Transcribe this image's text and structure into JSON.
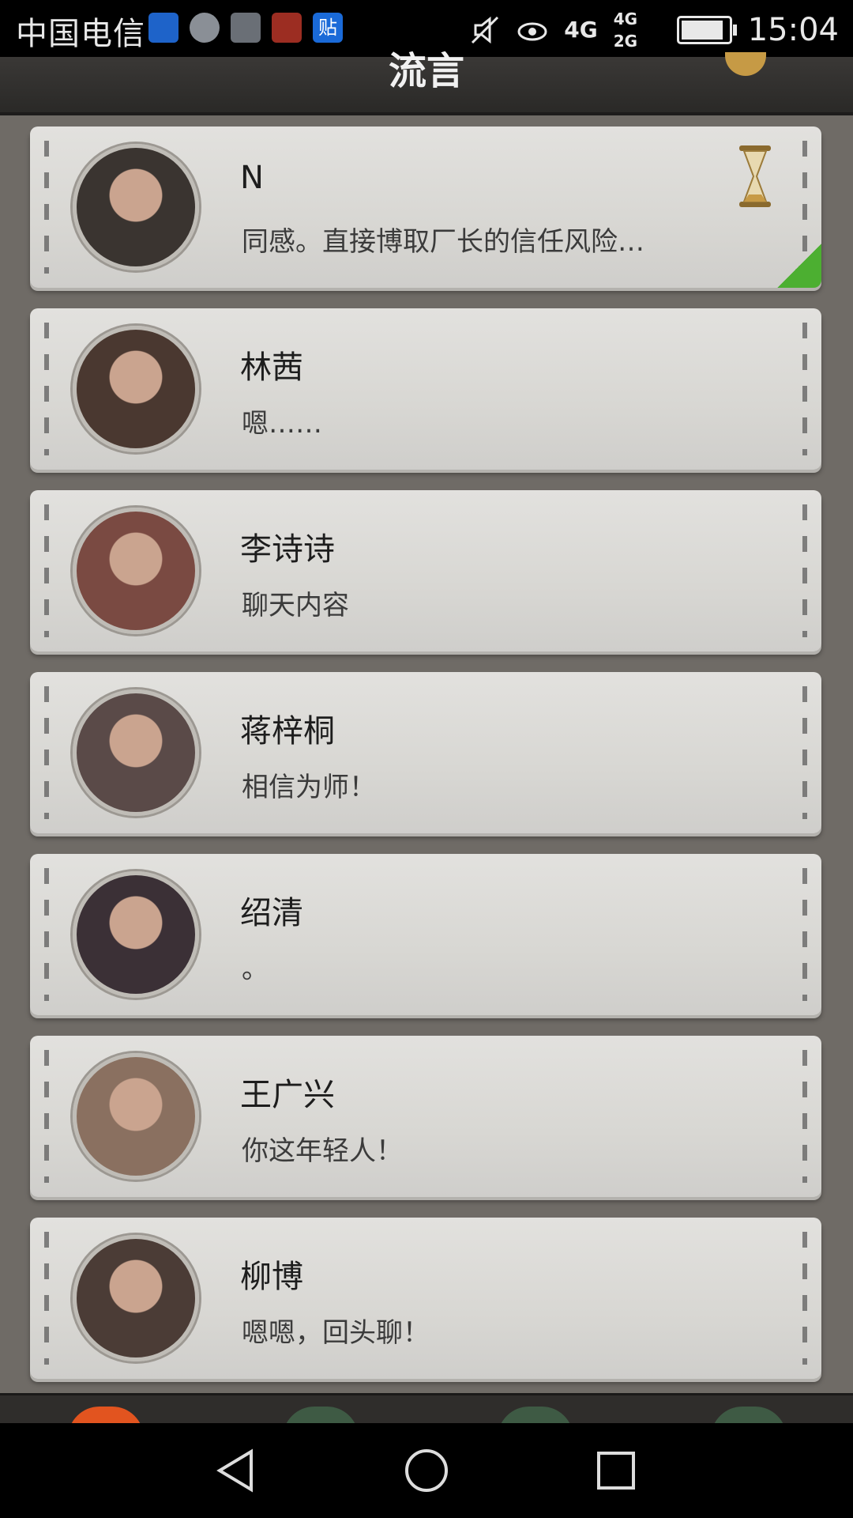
{
  "status_bar": {
    "carrier": "中国电信",
    "notification_icons": [
      "health-icon",
      "contact-icon",
      "gallery-icon",
      "photo-app-icon",
      "tieba-icon"
    ],
    "notif_label_tieba": "贴",
    "network_4g": "4G",
    "network_dual": "4G 2G",
    "time": "15:04"
  },
  "header": {
    "title": "流言"
  },
  "contacts": [
    {
      "name": "N",
      "message": "同感。直接博取厂长的信任风险…",
      "has_timer": true,
      "avatar_color": "#3a3430"
    },
    {
      "name": "林茜",
      "message": "嗯……",
      "has_timer": false,
      "avatar_color": "#4a3830"
    },
    {
      "name": "李诗诗",
      "message": "聊天内容",
      "has_timer": false,
      "avatar_color": "#7a4a42"
    },
    {
      "name": "蒋梓桐",
      "message": "相信为师！",
      "has_timer": false,
      "avatar_color": "#5a4a48"
    },
    {
      "name": "绍清",
      "message": "。",
      "has_timer": false,
      "avatar_color": "#3b3036"
    },
    {
      "name": "王广兴",
      "message": "你这年轻人！",
      "has_timer": false,
      "avatar_color": "#8a7060"
    },
    {
      "name": "柳博",
      "message": "嗯嗯，回头聊！",
      "has_timer": false,
      "avatar_color": "#4b3c36"
    }
  ],
  "colors": {
    "accent_tab": "#e2541f",
    "inactive_tab": "#3e5a44",
    "card_bg": "#dcdbd8",
    "page_bg": "#6f6b66"
  }
}
